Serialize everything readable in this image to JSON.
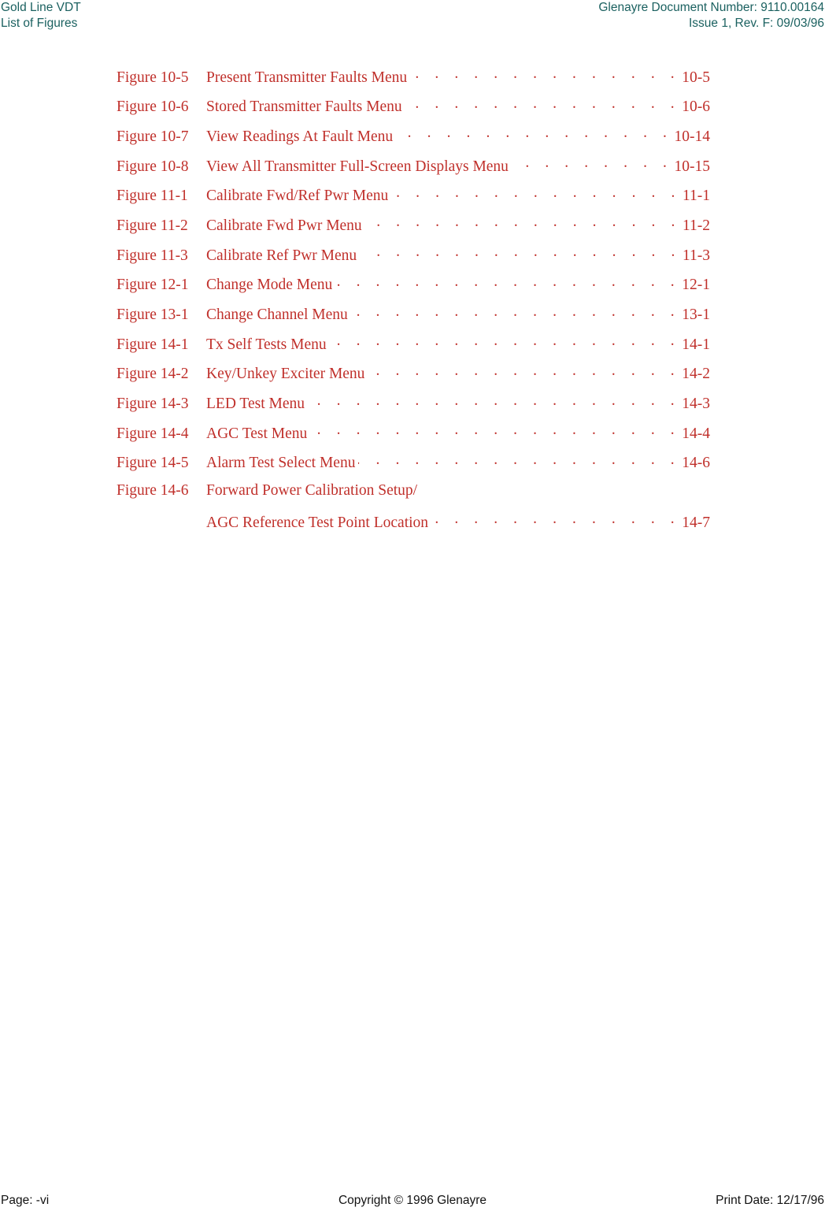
{
  "header": {
    "left_line1": "Gold Line VDT",
    "left_line2": "List of Figures",
    "right_line1": "Glenayre Document Number: 9110.00164",
    "right_line2": "Issue 1, Rev. F: 09/03/96",
    "color": "#1b6160"
  },
  "list_of_figures": {
    "entry_color": "#c0302b",
    "entries": [
      {
        "label": "Figure 10-5",
        "title": "Present Transmitter Faults Menu",
        "page": "10-5"
      },
      {
        "label": "Figure 10-6",
        "title": "Stored Transmitter Faults Menu",
        "page": "10-6"
      },
      {
        "label": "Figure 10-7",
        "title": "View Readings At Fault Menu",
        "page": "10-14"
      },
      {
        "label": "Figure 10-8",
        "title": "View All Transmitter Full-Screen Displays Menu",
        "page": "10-15"
      },
      {
        "label": "Figure 11-1",
        "title": "Calibrate Fwd/Ref Pwr Menu",
        "page": "11-1"
      },
      {
        "label": "Figure 11-2",
        "title": "Calibrate Fwd Pwr Menu",
        "page": "11-2"
      },
      {
        "label": "Figure 11-3",
        "title": "Calibrate Ref Pwr Menu",
        "page": "11-3"
      },
      {
        "label": "Figure 12-1",
        "title": "Change Mode Menu",
        "page": "12-1"
      },
      {
        "label": "Figure 13-1",
        "title": "Change Channel Menu",
        "page": "13-1"
      },
      {
        "label": "Figure 14-1",
        "title": "Tx Self Tests Menu",
        "page": "14-1"
      },
      {
        "label": "Figure 14-2",
        "title": "Key/Unkey Exciter Menu",
        "page": "14-2"
      },
      {
        "label": "Figure 14-3",
        "title": "LED Test Menu",
        "page": "14-3"
      },
      {
        "label": "Figure 14-4",
        "title": "AGC Test Menu",
        "page": "14-4"
      },
      {
        "label": "Figure 14-5",
        "title": "Alarm Test Select Menu",
        "page": "14-6"
      },
      {
        "label": "Figure 14-6",
        "title": "Forward Power Calibration Setup/",
        "page": "",
        "no_leader": true
      },
      {
        "label": "",
        "title": "AGC Reference Test Point Location",
        "page": "14-7",
        "continuation": true
      }
    ]
  },
  "footer": {
    "left": "Page: -vi",
    "center": "Copyright © 1996 Glenayre",
    "right": "Print Date: 12/17/96",
    "color": "#121212"
  }
}
